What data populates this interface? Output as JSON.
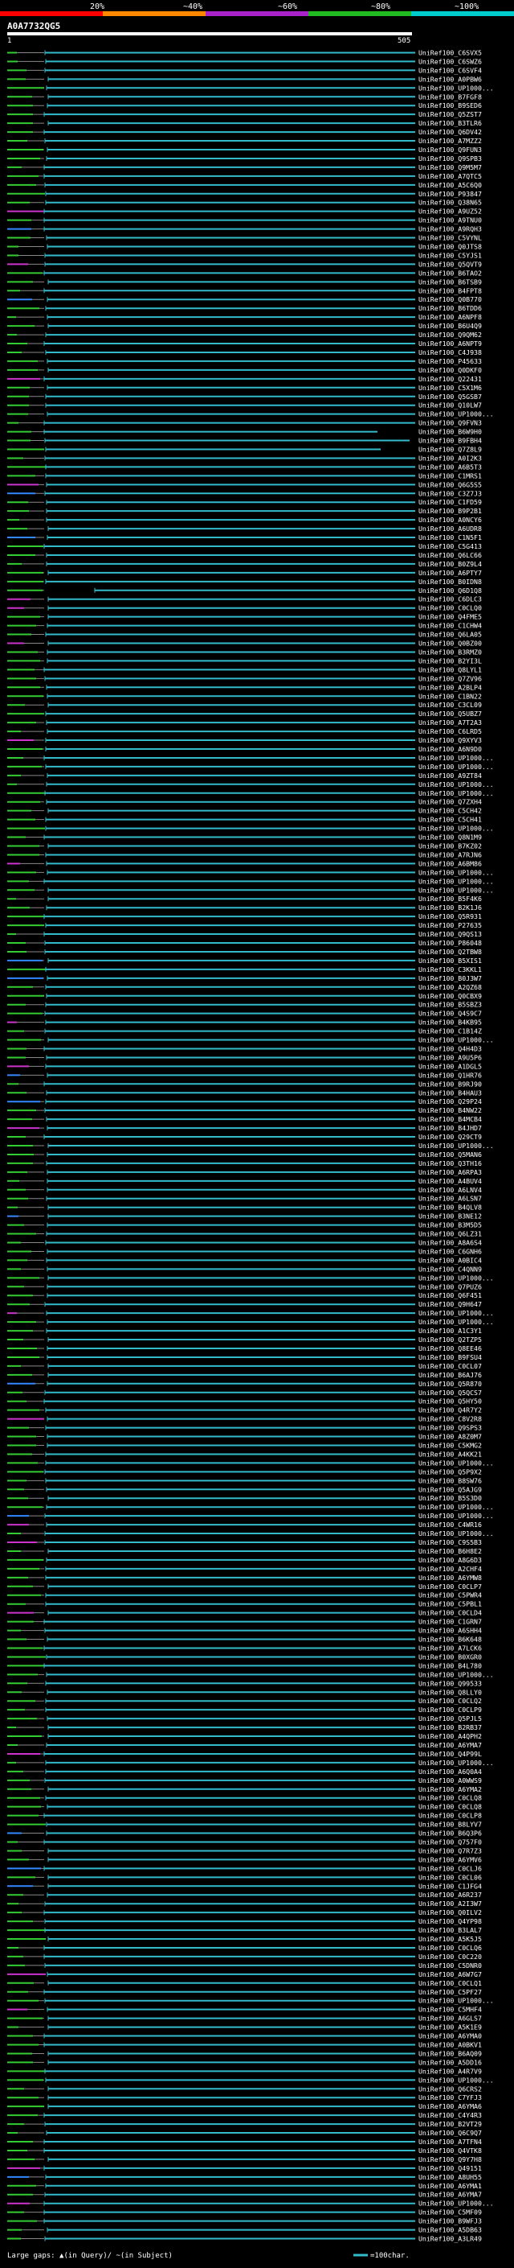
{
  "query": {
    "id": "A0A7732QG5",
    "start_label": "1",
    "end_label": "505"
  },
  "identity_scale": {
    "labels": [
      "20%",
      "~40%",
      "~60%",
      "~80%",
      "~100%"
    ],
    "colors": [
      "#ff0000",
      "#ff8800",
      "#aa22cc",
      "#22bb22",
      "#00cccc"
    ]
  },
  "colors": {
    "grey": "#888888",
    "green": "#33cc33",
    "cyan": "#33bbcc",
    "magenta": "#cc33cc",
    "blue": "#3388ff",
    "white": "#ffffff"
  },
  "footer": {
    "gaps_text": "Large gaps: ▲(in Query)/ ~(in Subject)",
    "scale_text": "=100char."
  },
  "hits": [
    "UniRef100_C6SVX5",
    "UniRef100_C6SWZ6",
    "UniRef100_C6SVF4",
    "UniRef100_A0PBW6",
    "UniRef100_UP1000...",
    "UniRef100_B7FGF8",
    "UniRef100_B9SED6",
    "UniRef100_Q5ZST7",
    "UniRef100_B3TLR6",
    "UniRef100_Q6DV42",
    "UniRef100_A7MZZ2",
    "UniRef100_Q9FUN3",
    "UniRef100_Q9SPB3",
    "UniRef100_Q9M5M7",
    "UniRef100_A7QTC5",
    "UniRef100_A5C6Q0",
    "UniRef100_P93847",
    "UniRef100_Q38N65",
    "UniRef100_A9UZ52",
    "UniRef100_A9TNU0",
    "UniRef100_A9RQH3",
    "UniRef100_C5VYNL",
    "UniRef100_Q0JTS8",
    "UniRef100_C5YJS1",
    "UniRef100_Q5QVT9",
    "UniRef100_B6TAO2",
    "UniRef100_B6TSB9",
    "UniRef100_B4FPT8",
    "UniRef100_Q0B770",
    "UniRef100_B6TDD6",
    "UniRef100_A6NPF8",
    "UniRef100_B6U4Q9",
    "UniRef100_Q9QM62",
    "UniRef100_A6NPT9",
    "UniRef100_C4J938",
    "UniRef100_P45633",
    "UniRef100_Q0DKF0",
    "UniRef100_Q22431",
    "UniRef100_C5X1M6",
    "UniRef100_Q5GSB7",
    "UniRef100_Q10LW7",
    "UniRef100_UP1000...",
    "UniRef100_Q9FVN3",
    "UniRef100_B6W9H0",
    "UniRef100_B9FBH4",
    "UniRef100_Q7Z8L9",
    "UniRef100_A0I2K3",
    "UniRef100_A6B5T3",
    "UniRef100_C1MRS1",
    "UniRef100_Q6G5S5",
    "UniRef100_C3Z7J3",
    "UniRef100_C1FD59",
    "UniRef100_B9P2B1",
    "UniRef100_A0NCY6",
    "UniRef100_A6UDR8",
    "UniRef100_C1N5F1",
    "UniRef100_C5G413",
    "UniRef100_Q6LC66",
    "UniRef100_B0Z9L4",
    "UniRef100_A6PTY7",
    "UniRef100_B0IDN8",
    "UniRef100_Q6D1Q8",
    "UniRef100_C6DLC3",
    "UniRef100_C0CLQ0",
    "UniRef100_Q4FME5",
    "UniRef100_C1CHW4",
    "UniRef100_Q6LA05",
    "UniRef100_Q0BZ00",
    "UniRef100_B3RMZ0",
    "UniRef100_B2YI3L",
    "UniRef100_Q8LYL1",
    "UniRef100_Q7ZV96",
    "UniRef100_A2BLP4",
    "UniRef100_C1BN22",
    "UniRef100_C3CL09",
    "UniRef100_Q5UBZ7",
    "UniRef100_A7T2A3",
    "UniRef100_C6LRD5",
    "UniRef100_Q9XYV3",
    "UniRef100_A6N9D0",
    "UniRef100_UP1000...",
    "UniRef100_UP1000...",
    "UniRef100_A9ZT84",
    "UniRef100_UP1000...",
    "UniRef100_UP1000...",
    "UniRef100_Q7ZXH4",
    "UniRef100_C5CH42",
    "UniRef100_C5CH41",
    "UniRef100_UP1000...",
    "UniRef100_Q8N1M9",
    "UniRef100_B7KZ02",
    "UniRef100_A7RJN6",
    "UniRef100_A6BM86",
    "UniRef100_UP1000...",
    "UniRef100_UP1000...",
    "UniRef100_UP1000...",
    "UniRef100_B5F4K6",
    "UniRef100_B2K1J6",
    "UniRef100_Q5R931",
    "UniRef100_P27635",
    "UniRef100_Q9QS13",
    "UniRef100_P86048",
    "UniRef100_Q2TBW8",
    "UniRef100_B5XIS1",
    "UniRef100_C3KKL1",
    "UniRef100_B0J3W7",
    "UniRef100_A2QZ68",
    "UniRef100_Q0CBX9",
    "UniRef100_B5SBZ3",
    "UniRef100_Q4S9C7",
    "UniRef100_B4KB95",
    "UniRef100_C1B14Z",
    "UniRef100_UP1000...",
    "UniRef100_Q4H4D3",
    "UniRef100_A9U5P6",
    "UniRef100_A1DGL5",
    "UniRef100_Q1HR76",
    "UniRef100_B9RJ90",
    "UniRef100_B4HAU3",
    "UniRef100_Q29P24",
    "UniRef100_B4NW22",
    "UniRef100_B4MCB4",
    "UniRef100_B4JHD7",
    "UniRef100_Q29CT9",
    "UniRef100_UP1000...",
    "UniRef100_Q5MAN6",
    "UniRef100_Q3TH16",
    "UniRef100_A6RPA3",
    "UniRef100_A4BUV4",
    "UniRef100_A6LNV4",
    "UniRef100_A6LSN7",
    "UniRef100_B4QLV8",
    "UniRef100_B3NE12",
    "UniRef100_B3M5D5",
    "UniRef100_Q6LZ31",
    "UniRef100_A8A6S4",
    "UniRef100_C6GNH6",
    "UniRef100_A0BIC4",
    "UniRef100_C4QNN9",
    "UniRef100_UP1000...",
    "UniRef100_Q7PUZ6",
    "UniRef100_Q6F451",
    "UniRef100_Q9H647",
    "UniRef100_UP1000...",
    "UniRef100_UP1000...",
    "UniRef100_A1C3Y1",
    "UniRef100_Q2TZP5",
    "UniRef100_Q8EE46",
    "UniRef100_B9FSU4",
    "UniRef100_C0CL07",
    "UniRef100_B6AJ76",
    "UniRef100_Q5R870",
    "UniRef100_Q5QCS7",
    "UniRef100_Q5HY50",
    "UniRef100_Q4R7Y2",
    "UniRef100_C8V2R8",
    "UniRef100_Q9SPS3",
    "UniRef100_A8Z0M7",
    "UniRef100_C5KMG2",
    "UniRef100_A4KK21",
    "UniRef100_UP1000...",
    "UniRef100_Q5P9X2",
    "UniRef100_B8SW76",
    "UniRef100_Q5AJG9",
    "UniRef100_B5S3D0",
    "UniRef100_UP1000...",
    "UniRef100_UP1000...",
    "UniRef100_C4WR16",
    "UniRef100_UP1000...",
    "UniRef100_C9S5B3",
    "UniRef100_B6H8E2",
    "UniRef100_A8G6D3",
    "UniRef100_A2CHF4",
    "UniRef100_A6YMW8",
    "UniRef100_C0CLP7",
    "UniRef100_C5PWR4",
    "UniRef100_C5PBL1",
    "UniRef100_C0CLD4",
    "UniRef100_C1GRN7",
    "UniRef100_A6SHH4",
    "UniRef100_B6K648",
    "UniRef100_A7LCK6",
    "UniRef100_B0XGR0",
    "UniRef100_B4L780",
    "UniRef100_UP1000...",
    "UniRef100_Q99533",
    "UniRef100_Q8LLY0",
    "UniRef100_C0CLQ2",
    "UniRef100_C0CLP9",
    "UniRef100_Q5PJL5",
    "UniRef100_B2RB37",
    "UniRef100_A4QPH2",
    "UniRef100_A6YMA7",
    "UniRef100_Q4P99L",
    "UniRef100_UP1000...",
    "UniRef100_A6Q0A4",
    "UniRef100_A0WWS9",
    "UniRef100_A6YMA2",
    "UniRef100_C0CLQ8",
    "UniRef100_C0CLQ8",
    "UniRef100_C0CLP8",
    "UniRef100_B8LYV7",
    "UniRef100_B6Q3P6",
    "UniRef100_Q757F0",
    "UniRef100_Q7R7Z3",
    "UniRef100_A6YMV6",
    "UniRef100_C0CLJ6",
    "UniRef100_C0CL06",
    "UniRef100_C1JFG4",
    "UniRef100_A6R237",
    "UniRef100_A2I3W7",
    "UniRef100_Q0ILV2",
    "UniRef100_Q4YP98",
    "UniRef100_B3LAL7",
    "UniRef100_A5K5J5",
    "UniRef100_C0CLQ6",
    "UniRef100_C0C220",
    "UniRef100_C5DNR0",
    "UniRef100_A6W7G7",
    "UniRef100_C0CLQ1",
    "UniRef100_C5PF27",
    "UniRef100_UP1000...",
    "UniRef100_C5MHF4",
    "UniRef100_A6GLS7",
    "UniRef100_A5K1E9",
    "UniRef100_A6YMA0",
    "UniRef100_A0BKV1",
    "UniRef100_B6AQ09",
    "UniRef100_A5DD16",
    "UniRef100_A4R7V9",
    "UniRef100_UP1000...",
    "UniRef100_Q6CRS2",
    "UniRef100_C7YFJ3",
    "UniRef100_A6YMA6",
    "UniRef100_C4Y4R3",
    "UniRef100_B2VT29",
    "UniRef100_Q6C9Q7",
    "UniRef100_A7TFN4",
    "UniRef100_Q4VTK8",
    "UniRef100_Q9Y7H8",
    "UniRef100_Q49151",
    "UniRef100_A8UH55",
    "UniRef100_A6YMA1",
    "UniRef100_A6YMA7",
    "UniRef100_UP1000...",
    "UniRef100_C5MF09",
    "UniRef100_B9WFJ3",
    "UniRef100_A5DB63",
    "UniRef100_A3LR49"
  ]
}
